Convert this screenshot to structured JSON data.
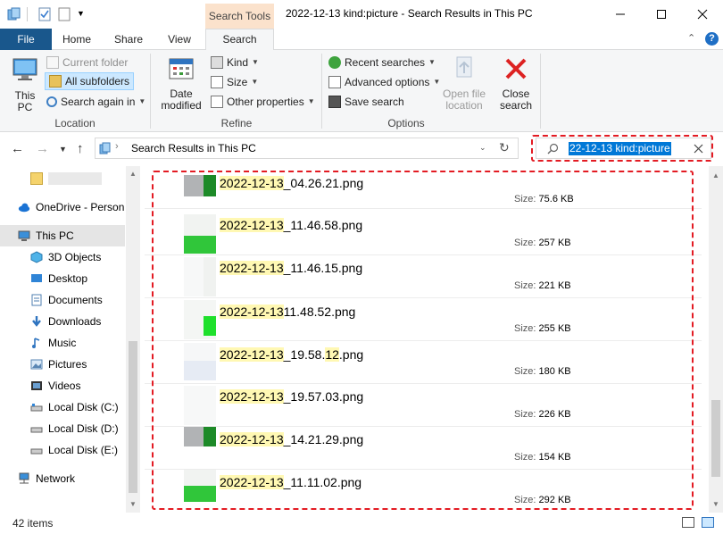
{
  "titlebar": {
    "context_tab": "Search Tools",
    "title": "2022-12-13 kind:picture - Search Results in This PC",
    "minimize_icon": "minimize-icon",
    "maximize_icon": "maximize-icon",
    "close_icon": "close-icon"
  },
  "ribbon_tabs": {
    "file": "File",
    "home": "Home",
    "share": "Share",
    "view": "View",
    "search": "Search"
  },
  "ribbon": {
    "location": {
      "label": "Location",
      "this_pc": "This PC",
      "current_folder": "Current folder",
      "all_subfolders": "All subfolders",
      "search_again_in": "Search again in"
    },
    "refine": {
      "label": "Refine",
      "date_modified": "Date modified",
      "kind": "Kind",
      "size": "Size",
      "other_properties": "Other properties"
    },
    "options": {
      "label": "Options",
      "recent_searches": "Recent searches",
      "advanced_options": "Advanced options",
      "save_search": "Save search",
      "open_file_location": "Open file location",
      "close_search": "Close search"
    }
  },
  "address": {
    "path": "Search Results in This PC",
    "search_query": "22-12-13 kind:picture"
  },
  "nav_pane": {
    "items": [
      {
        "label": "",
        "icon": "folder-icon"
      },
      {
        "label": "OneDrive - Person",
        "icon": "onedrive-icon"
      },
      {
        "label": "This PC",
        "icon": "computer-icon"
      },
      {
        "label": "3D Objects",
        "icon": "3d-objects-icon"
      },
      {
        "label": "Desktop",
        "icon": "desktop-icon"
      },
      {
        "label": "Documents",
        "icon": "documents-icon"
      },
      {
        "label": "Downloads",
        "icon": "downloads-icon"
      },
      {
        "label": "Music",
        "icon": "music-icon"
      },
      {
        "label": "Pictures",
        "icon": "pictures-icon"
      },
      {
        "label": "Videos",
        "icon": "videos-icon"
      },
      {
        "label": "Local Disk (C:)",
        "icon": "drive-icon"
      },
      {
        "label": "Local Disk (D:)",
        "icon": "drive-icon"
      },
      {
        "label": "Local Disk (E:)",
        "icon": "drive-icon"
      },
      {
        "label": "Network",
        "icon": "network-icon"
      }
    ]
  },
  "results": {
    "size_label": "Size:",
    "files": [
      {
        "hl": "2022-12-13",
        "mid": "_04.26.21.png",
        "hl2": "",
        "rest": "",
        "size": "75.6 KB"
      },
      {
        "hl": "2022-12-13",
        "mid": "_11.46.58.png",
        "hl2": "",
        "rest": "",
        "size": "257 KB"
      },
      {
        "hl": "2022-12-13",
        "mid": "_11.46.15.png",
        "hl2": "",
        "rest": "",
        "size": "221 KB"
      },
      {
        "hl": "2022-12-13",
        "mid": "11.48.52.png",
        "hl2": "",
        "rest": "",
        "size": "255 KB"
      },
      {
        "hl": "2022-12-13",
        "mid": "_19.58.",
        "hl2": "12",
        "rest": ".png",
        "size": "180 KB"
      },
      {
        "hl": "2022-12-13",
        "mid": "_19.57.03.png",
        "hl2": "",
        "rest": "",
        "size": "226 KB"
      },
      {
        "hl": "2022-12-13",
        "mid": "_14.21.29.png",
        "hl2": "",
        "rest": "",
        "size": "154 KB"
      },
      {
        "hl": "2022-12-13",
        "mid": "_11.11.02.png",
        "hl2": "",
        "rest": "",
        "size": "292 KB"
      }
    ]
  },
  "status": {
    "items_count": "42 items"
  },
  "colors": {
    "file_tab": "#19578c",
    "context_tab": "#fbe2cc",
    "selection": "#0078d7",
    "highlight": "#fff8b3",
    "annotation_red": "#e31b23"
  }
}
